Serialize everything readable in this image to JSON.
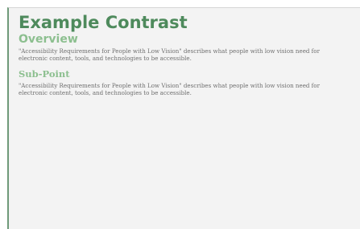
{
  "page": {
    "title": "Example Contrast",
    "sections": [
      {
        "heading": "Overview",
        "text": "\"Accessibility Requirements for People with Low Vision\" describes what people with low vision need for electronic content, tools, and technologies to be accessible."
      },
      {
        "heading": "Sub-Point",
        "text": "\"Accessibility Requirements for People with Low Vision\" describes what people with low vision need for electronic content, tools, and technologies to be accessible."
      }
    ]
  },
  "colors": {
    "title": "#4e8a5c",
    "heading": "#8cbf8f",
    "body_text": "#6f6f6f",
    "panel_background": "#f3f3f3",
    "accent_border": "#6f9a7a"
  }
}
